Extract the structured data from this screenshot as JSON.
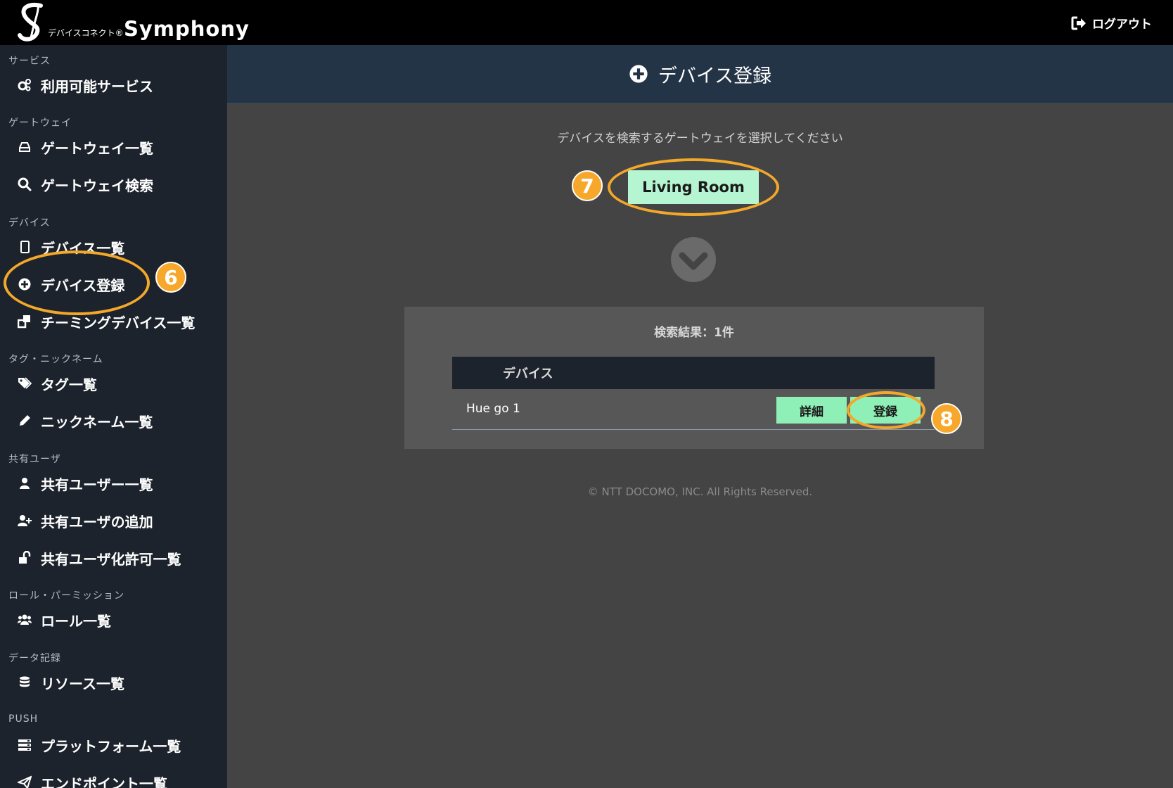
{
  "brand": {
    "small": "デバイスコネクト",
    "mark": "®",
    "big": "Symphony"
  },
  "header": {
    "logout_label": "ログアウト"
  },
  "sidebar": {
    "sections": [
      {
        "label": "サービス"
      },
      {
        "label": "ゲートウェイ"
      },
      {
        "label": "デバイス"
      },
      {
        "label": "タグ・ニックネーム"
      },
      {
        "label": "共有ユーザ"
      },
      {
        "label": "ロール・パーミッション"
      },
      {
        "label": "データ記録"
      },
      {
        "label": "PUSH"
      }
    ],
    "items": [
      {
        "label": "利用可能サービス",
        "icon": "gears-icon"
      },
      {
        "label": "ゲートウェイ一覧",
        "icon": "hdd-icon"
      },
      {
        "label": "ゲートウェイ検索",
        "icon": "search-icon"
      },
      {
        "label": "デバイス一覧",
        "icon": "tablet-icon"
      },
      {
        "label": "デバイス登録",
        "icon": "plus-circle-icon"
      },
      {
        "label": "チーミングデバイス一覧",
        "icon": "clone-icon"
      },
      {
        "label": "タグ一覧",
        "icon": "tags-icon"
      },
      {
        "label": "ニックネーム一覧",
        "icon": "pencil-icon"
      },
      {
        "label": "共有ユーザー一覧",
        "icon": "user-icon"
      },
      {
        "label": "共有ユーザの追加",
        "icon": "user-plus-icon"
      },
      {
        "label": "共有ユーザ化許可一覧",
        "icon": "unlock-icon"
      },
      {
        "label": "ロール一覧",
        "icon": "users-icon"
      },
      {
        "label": "リソース一覧",
        "icon": "database-icon"
      },
      {
        "label": "プラットフォーム一覧",
        "icon": "server-icon"
      },
      {
        "label": "エンドポイント一覧",
        "icon": "paper-plane-icon"
      }
    ]
  },
  "main": {
    "title": "デバイス登録",
    "instruction": "デバイスを検索するゲートウェイを選択してください",
    "gateway_button": "Living Room",
    "results": {
      "title": "検索結果：1件",
      "column_header": "デバイス",
      "rows": [
        {
          "name": "Hue go 1",
          "detail_label": "詳細",
          "register_label": "登録"
        }
      ]
    },
    "copyright": "© NTT DOCOMO, INC. All Rights Reserved."
  },
  "annotations": {
    "step6": "6",
    "step7": "7",
    "step8": "8",
    "color": "#f4a82a"
  },
  "colors": {
    "accent_green": "#8ef0b6",
    "sidebar_bg": "#1d232c",
    "header_bg": "#243447",
    "main_bg": "#444444"
  }
}
